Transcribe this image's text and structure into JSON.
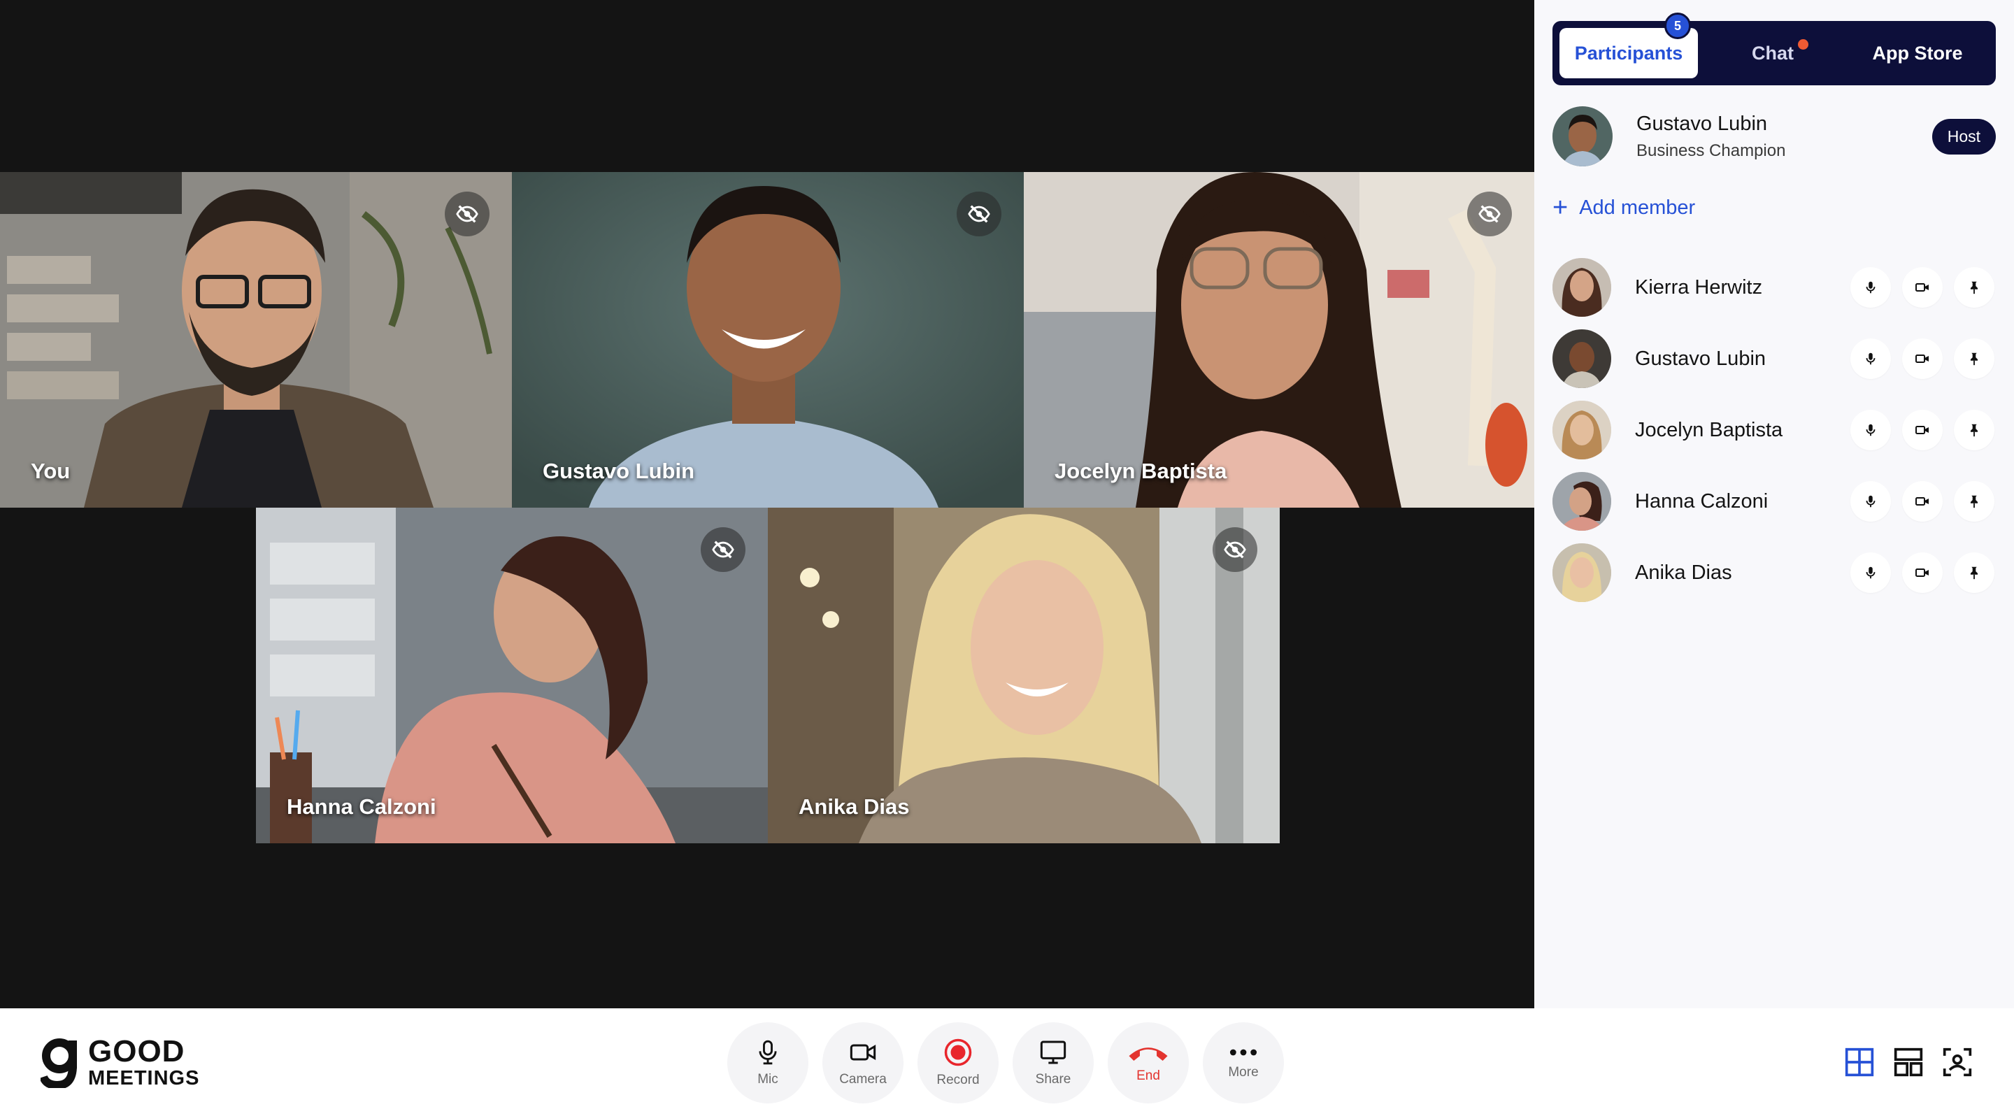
{
  "stage": {
    "tiles": [
      {
        "name": "You"
      },
      {
        "name": "Gustavo Lubin"
      },
      {
        "name": "Jocelyn Baptista"
      },
      {
        "name": "Hanna Calzoni"
      },
      {
        "name": "Anika Dias"
      }
    ]
  },
  "panel": {
    "tabs": {
      "participants": "Participants",
      "participants_count": "5",
      "chat": "Chat",
      "app_store": "App Store"
    },
    "host": {
      "name": "Gustavo Lubin",
      "role": "Business Champion",
      "badge": "Host"
    },
    "add_member": "Add member",
    "participants": [
      {
        "name": "Kierra Herwitz"
      },
      {
        "name": "Gustavo Lubin"
      },
      {
        "name": "Jocelyn Baptista"
      },
      {
        "name": "Hanna Calzoni"
      },
      {
        "name": "Anika Dias"
      }
    ]
  },
  "bottombar": {
    "logo_line1": "GOOD",
    "logo_line2": "MEETINGS",
    "controls": {
      "mic": "Mic",
      "camera": "Camera",
      "record": "Record",
      "share": "Share",
      "end": "End",
      "more": "More"
    }
  },
  "colors": {
    "accent": "#2651d6",
    "navy": "#0d0f3a",
    "end_red": "#e3342f",
    "record_red": "#e8262c",
    "stage_bg": "#141414"
  }
}
